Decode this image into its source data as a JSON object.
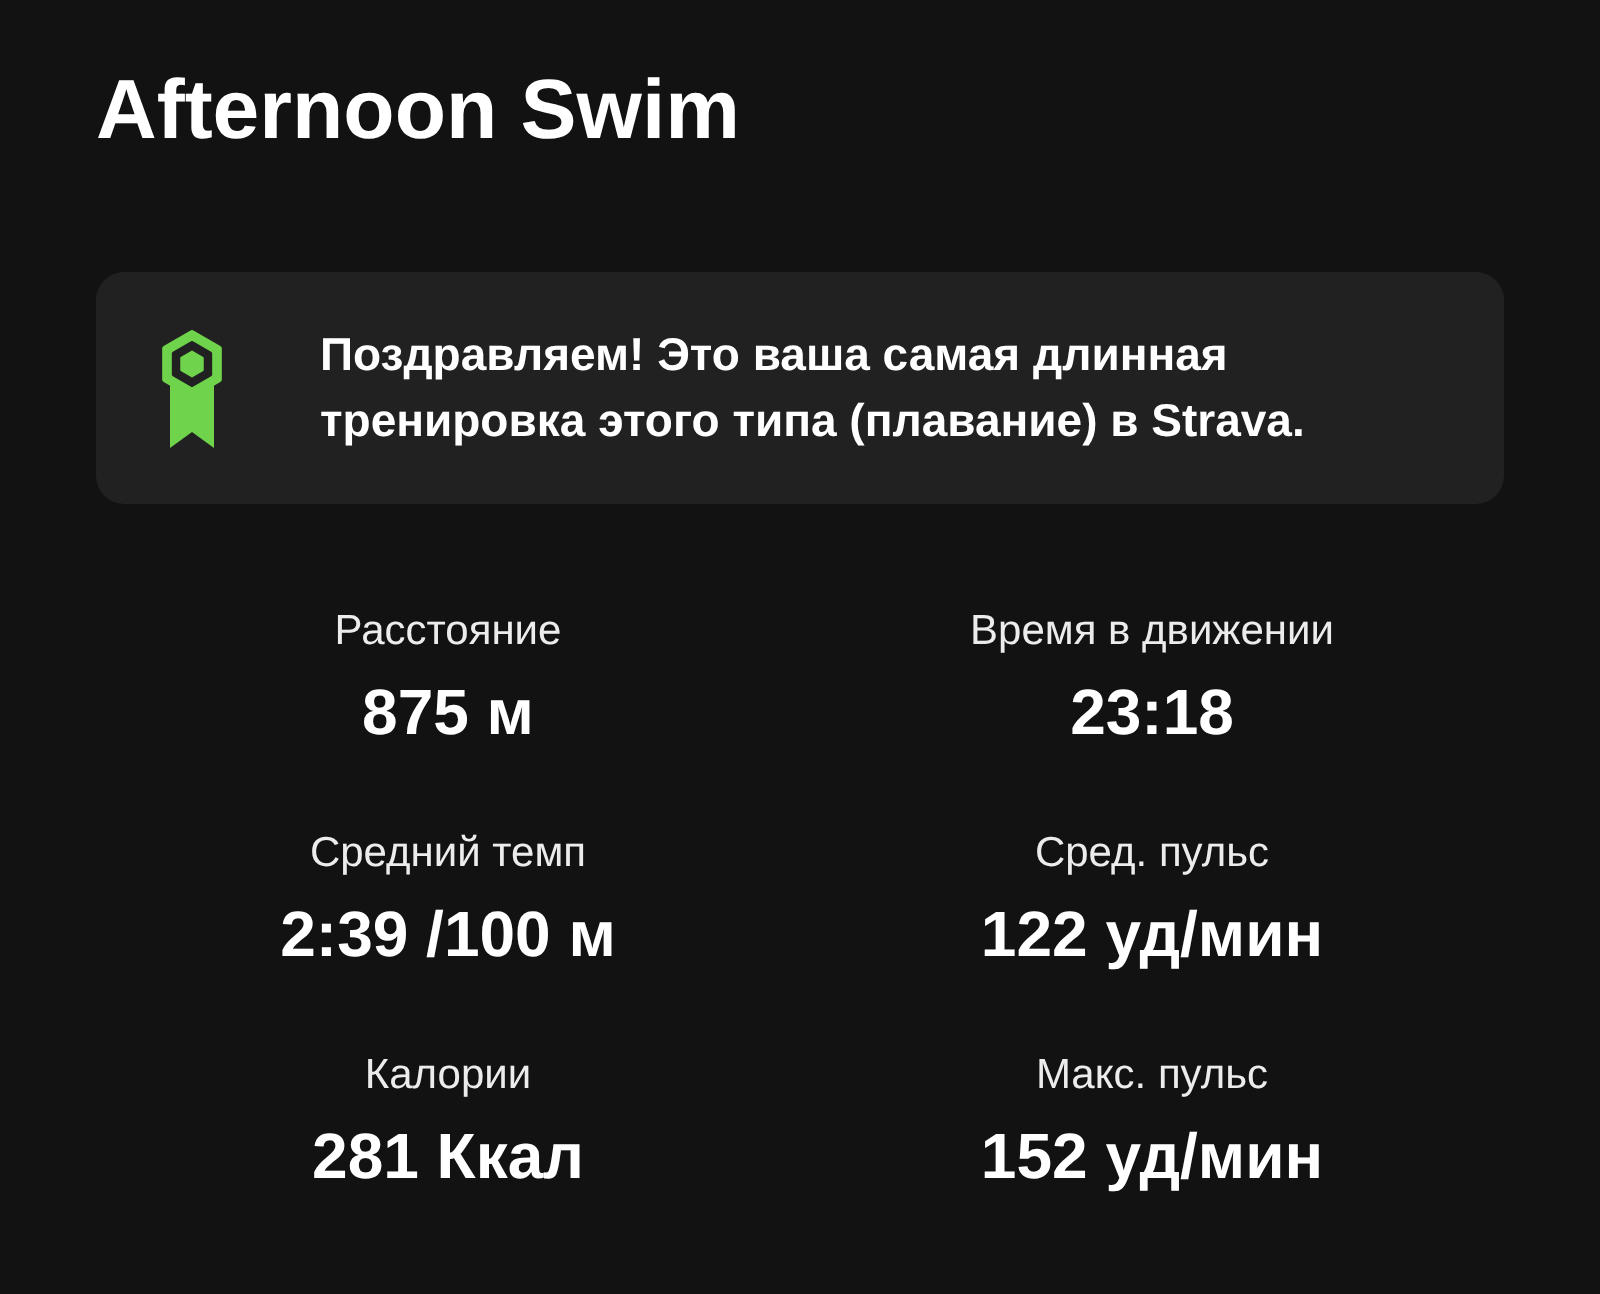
{
  "title": "Afternoon Swim",
  "achievement": {
    "message": "Поздравляем! Это ваша самая длинная тренировка этого типа (плавание) в Strava."
  },
  "stats": [
    {
      "label": "Расстояние",
      "value": "875 м"
    },
    {
      "label": "Время в движении",
      "value": "23:18"
    },
    {
      "label": "Средний темп",
      "value": "2:39 /100 м"
    },
    {
      "label": "Сред. пульс",
      "value": "122 уд/мин"
    },
    {
      "label": "Калории",
      "value": "281 Ккал"
    },
    {
      "label": "Макс. пульс",
      "value": "152 уд/мин"
    }
  ]
}
